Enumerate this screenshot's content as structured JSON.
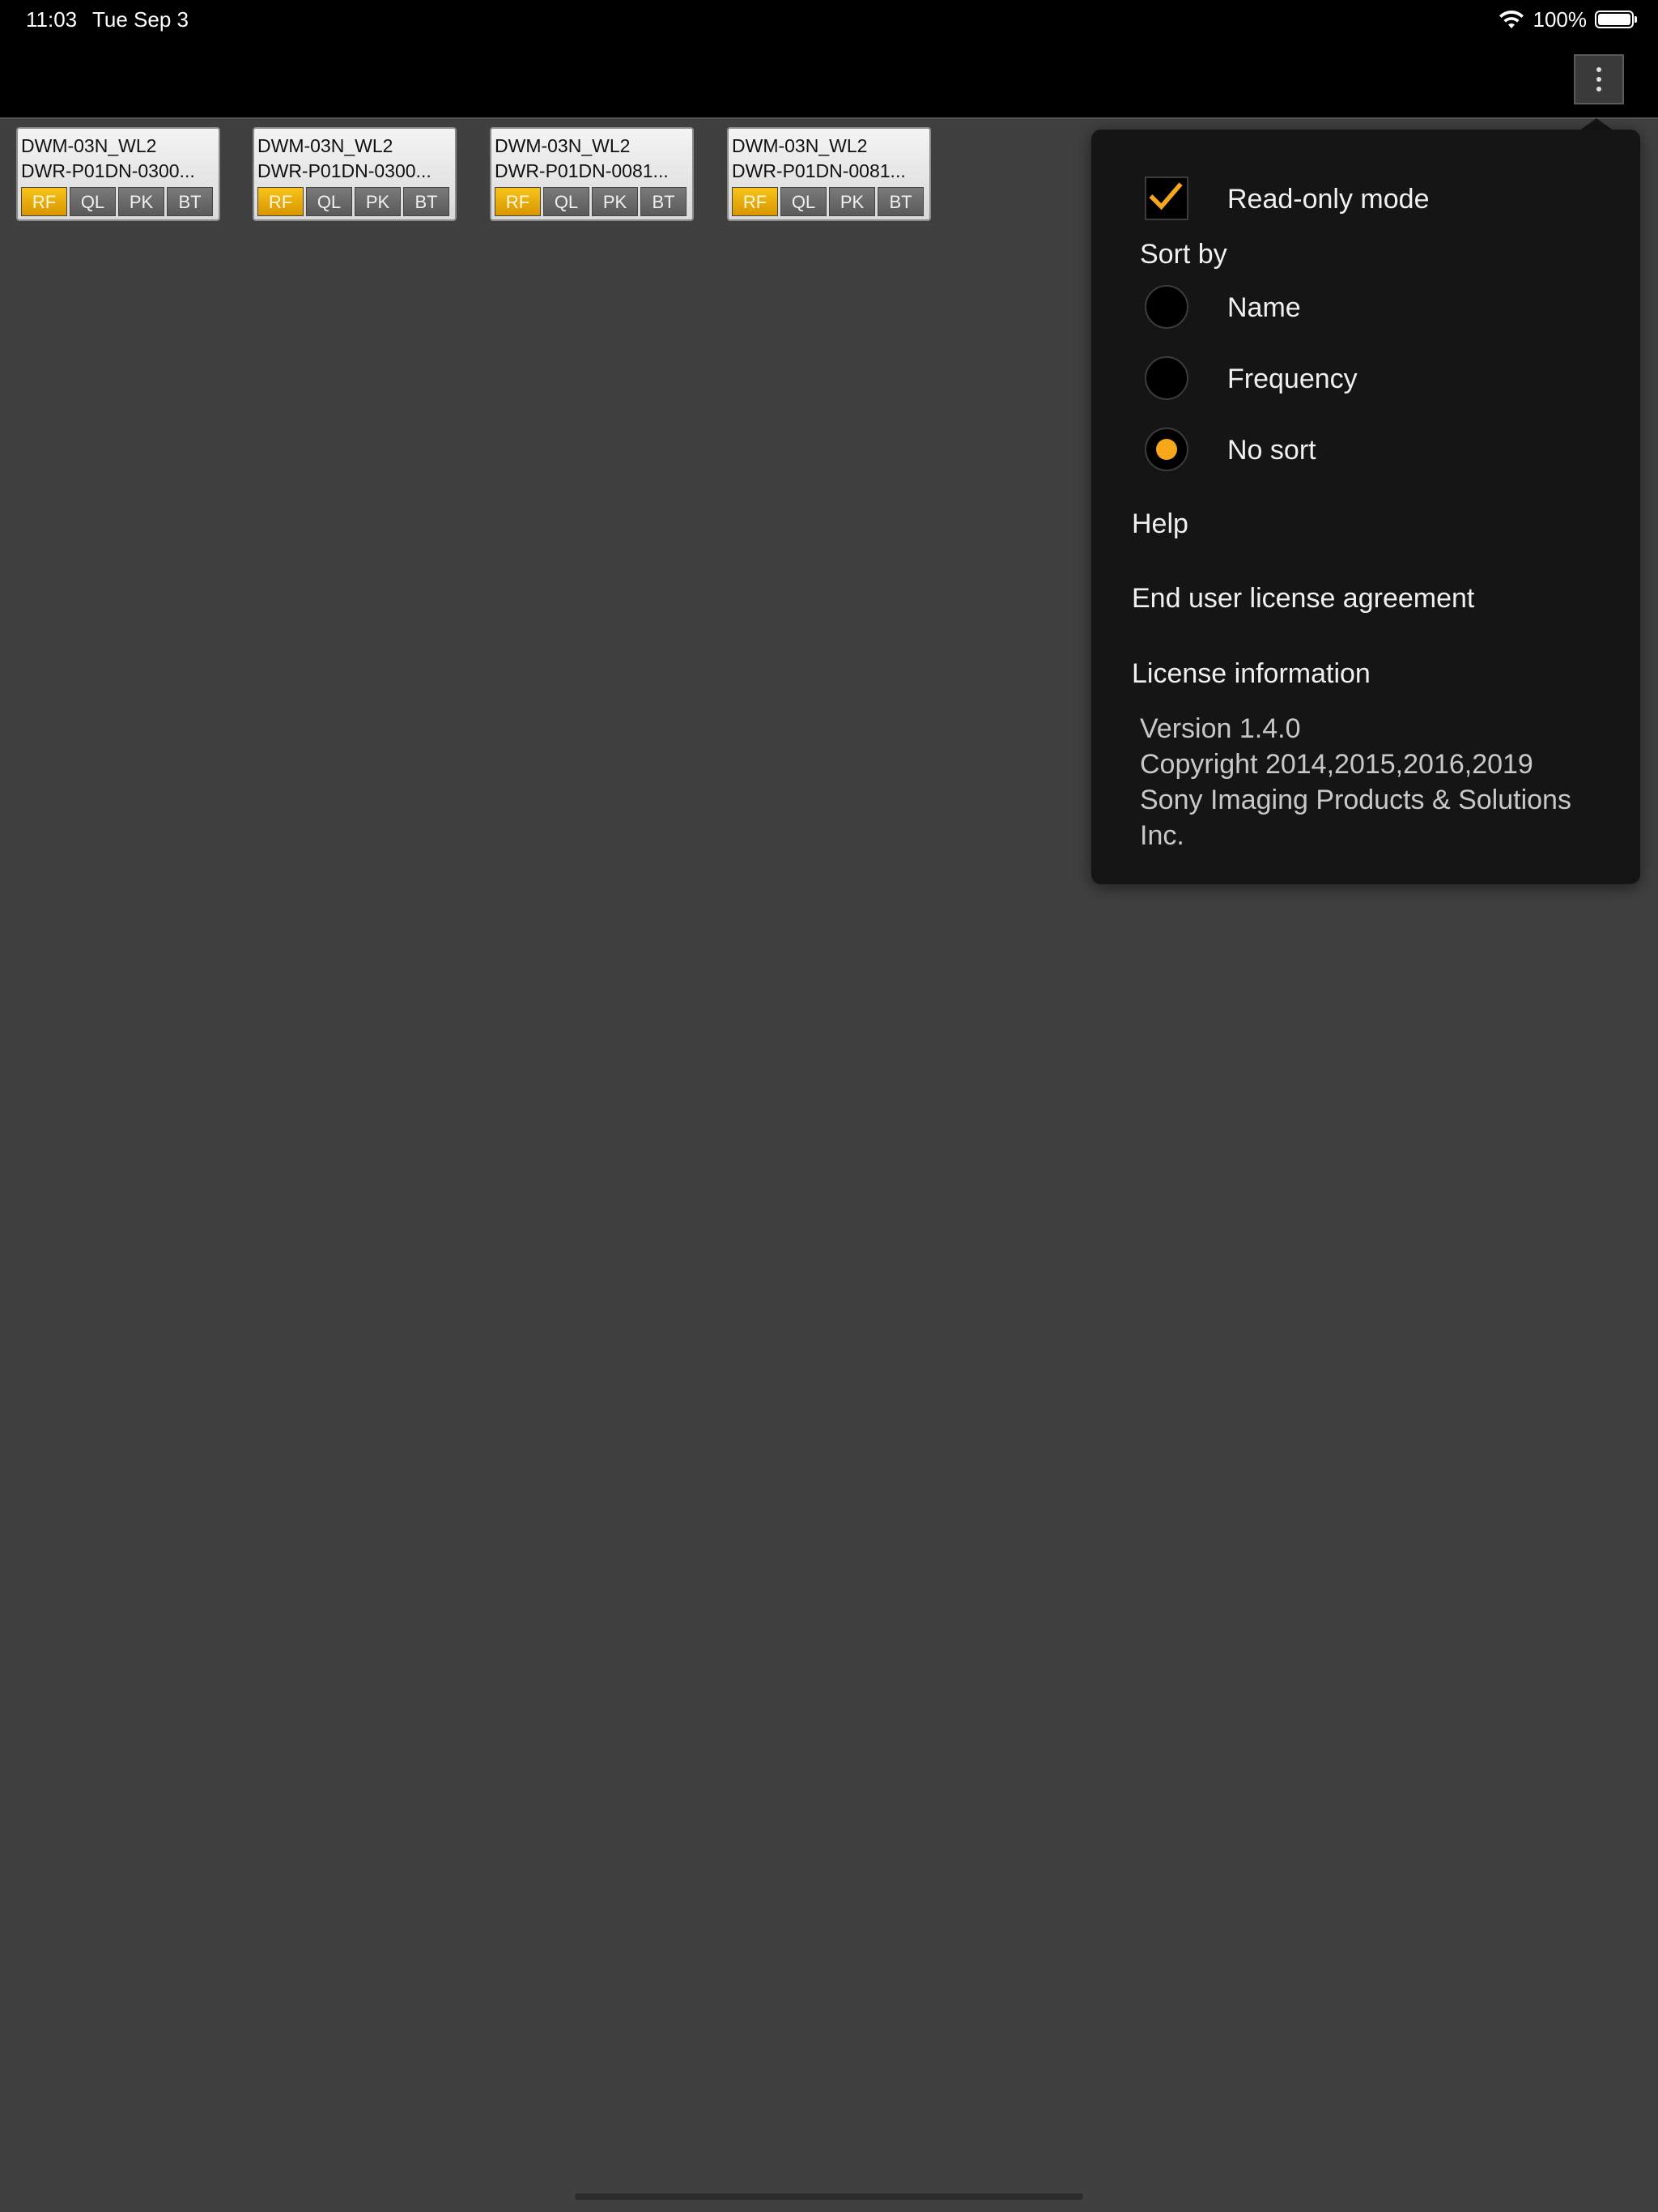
{
  "status_bar": {
    "time": "11:03",
    "date": "Tue Sep 3",
    "battery_text": "100%",
    "battery_level": 1.0
  },
  "toolbar": {
    "menu_icon": "more-vertical-icon"
  },
  "devices": [
    {
      "model": "DWM-03N_WL2",
      "name": "DWR-P01DN-0300...",
      "buttons": [
        "RF",
        "QL",
        "PK",
        "BT"
      ],
      "active": "RF"
    },
    {
      "model": "DWM-03N_WL2",
      "name": "DWR-P01DN-0300...",
      "buttons": [
        "RF",
        "QL",
        "PK",
        "BT"
      ],
      "active": "RF"
    },
    {
      "model": "DWM-03N_WL2",
      "name": "DWR-P01DN-0081...",
      "buttons": [
        "RF",
        "QL",
        "PK",
        "BT"
      ],
      "active": "RF"
    },
    {
      "model": "DWM-03N_WL2",
      "name": "DWR-P01DN-0081...",
      "buttons": [
        "RF",
        "QL",
        "PK",
        "BT"
      ],
      "active": "RF"
    }
  ],
  "menu": {
    "read_only": {
      "label": "Read-only mode",
      "checked": true
    },
    "sort_by": {
      "label": "Sort by",
      "options": [
        {
          "label": "Name",
          "selected": false
        },
        {
          "label": "Frequency",
          "selected": false
        },
        {
          "label": "No sort",
          "selected": true
        }
      ]
    },
    "help": "Help",
    "eula": "End user license agreement",
    "license": "License information",
    "version": "Version 1.4.0",
    "copyright": "Copyright 2014,2015,2016,2019",
    "company_line1": "Sony Imaging Products & Solutions",
    "company_line2": "Inc."
  },
  "colors": {
    "accent": "#f6a81a",
    "rf_active": "#e9ab0c",
    "background": "#404040",
    "popover": "#151515"
  }
}
